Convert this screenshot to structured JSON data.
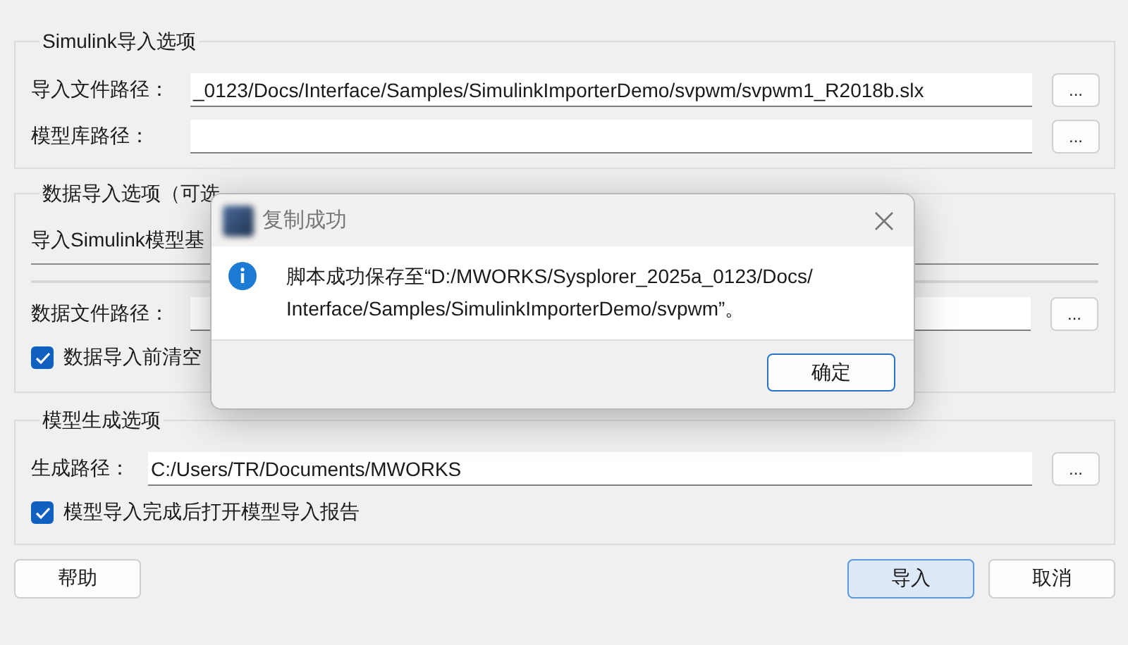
{
  "simulink_group": {
    "title": "Simulink导入选项",
    "rows": [
      {
        "label": "导入文件路径：",
        "value": "_0123/Docs/Interface/Samples/SimulinkImporterDemo/svpwm/svpwm1_R2018b.slx",
        "button": "..."
      },
      {
        "label": "模型库路径：",
        "value": "",
        "button": "..."
      }
    ]
  },
  "data_group": {
    "title": "数据导入选项（可选",
    "subtitle": "导入Simulink模型基",
    "file_row": {
      "label": "数据文件路径：",
      "button": "..."
    },
    "clear_checkbox": {
      "label": "数据导入前清空",
      "checked": true
    }
  },
  "model_group": {
    "title": "模型生成选项",
    "path_row": {
      "label": "生成路径：",
      "value": "C:/Users/TR/Documents/MWORKS",
      "button": "..."
    },
    "report_checkbox": {
      "label": "模型导入完成后打开模型导入报告",
      "checked": true
    }
  },
  "buttons": [
    {
      "label": "帮助",
      "selected": false
    },
    {
      "label": "导入",
      "selected": true
    },
    {
      "label": "取消",
      "selected": false
    }
  ],
  "dialog": {
    "title": "复制成功",
    "message_lines": [
      "脚本成功保存至“D:/MWORKS/Sysplorer_2025a_0123/Docs/",
      "Interface/Samples/SimulinkImporterDemo/svpwm”。"
    ],
    "button": "确定"
  }
}
